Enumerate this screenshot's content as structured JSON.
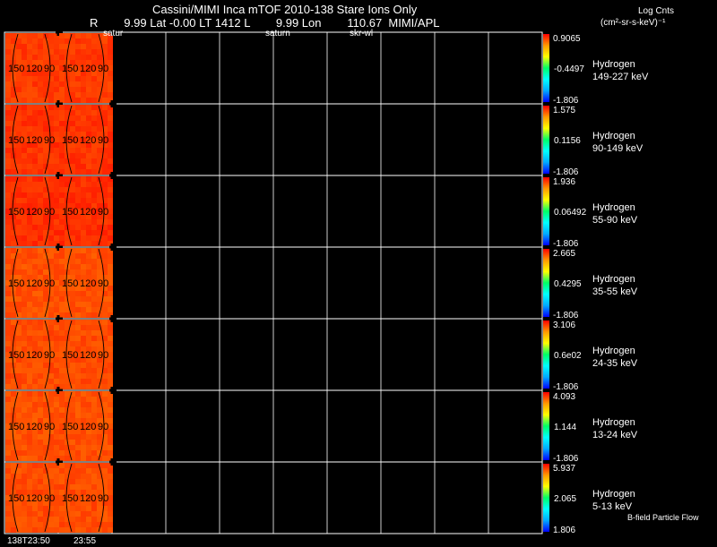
{
  "header": {
    "title": "Cassini/MIMI Inca mTOF  2010-138   Stare   Ions Only",
    "pos_line": "R        9.99 Lat -0.00 LT 1412 L        9.99 Lon        110.67  MIMI/APL",
    "label_a": "satur",
    "label_b": "saturn",
    "label_c": "skr-wl",
    "units_title": "Log Cnts",
    "units_sub": "(cm²-sr-s-keV)⁻¹"
  },
  "footer": {
    "time_left": "138T23:50",
    "time_right": "23:55",
    "bfield": "B-field Particle Flow"
  },
  "contour_labels": [
    "150",
    "120",
    "90"
  ],
  "colors": {
    "background": "#000000",
    "grid": "#ffffff",
    "colorbar": [
      "#0000ff",
      "#00aaff",
      "#00ffff",
      "#00ff66",
      "#ffff00",
      "#ff9900",
      "#ff0000"
    ]
  },
  "chart_data": {
    "type": "heatmap",
    "panels": [
      {
        "species": "Hydrogen",
        "energy": "149-227 keV",
        "cmax": "0.9065",
        "cmid": "-0.4497",
        "cmin": "-1.806",
        "level": 0.82
      },
      {
        "species": "Hydrogen",
        "energy": "90-149 keV",
        "cmax": "1.575",
        "cmid": "0.1156",
        "cmin": "-1.806",
        "level": 0.86
      },
      {
        "species": "Hydrogen",
        "energy": "55-90 keV",
        "cmax": "1.936",
        "cmid": "0.06492",
        "cmin": "-1.806",
        "level": 0.88
      },
      {
        "species": "Hydrogen",
        "energy": "35-55 keV",
        "cmax": "2.665",
        "cmid": "0.4295",
        "cmin": "-1.806",
        "level": 0.72
      },
      {
        "species": "Hydrogen",
        "energy": "24-35 keV",
        "cmax": "3.106",
        "cmid": "0.6e02",
        "cmin": "-1.806",
        "level": 0.74
      },
      {
        "species": "Hydrogen",
        "energy": "13-24 keV",
        "cmax": "4.093",
        "cmid": "1.144",
        "cmin": "-1.806",
        "level": 0.72
      },
      {
        "species": "Hydrogen",
        "energy": "5-13 keV",
        "cmax": "5.937",
        "cmid": "2.065",
        "cmin": "1.806",
        "level": 0.74
      }
    ]
  }
}
